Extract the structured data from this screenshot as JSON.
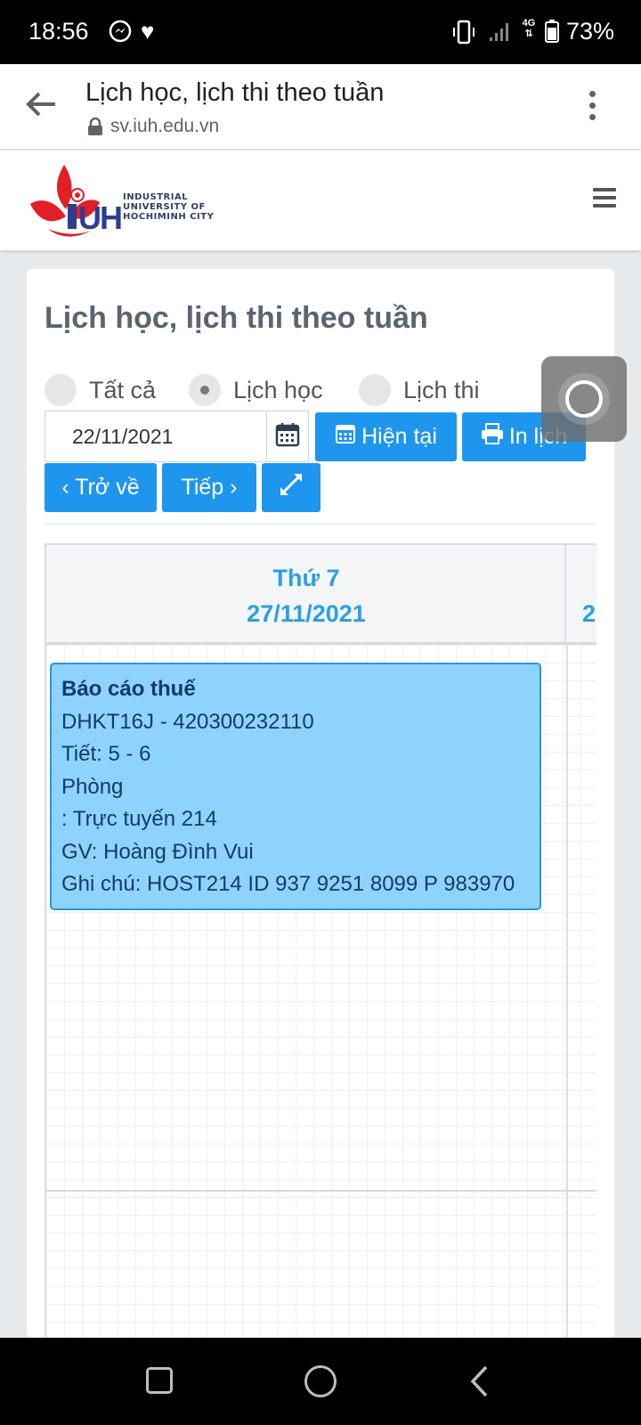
{
  "status_bar": {
    "time": "18:56",
    "network": "4G",
    "battery": "73%",
    "icons": [
      "messenger-icon",
      "heart-icon",
      "vibrate-icon",
      "signal-icon",
      "battery-icon"
    ]
  },
  "browser": {
    "title": "Lịch học, lịch thi theo tuần",
    "url": "sv.iuh.edu.vn"
  },
  "site": {
    "logo_lines": [
      "INDUSTRIAL",
      "UNIVERSITY OF",
      "HOCHIMINH CITY"
    ],
    "logo_letters": "IUH"
  },
  "page": {
    "title": "Lịch học, lịch thi theo tuần"
  },
  "filters": {
    "options": [
      {
        "label": "Tất cả",
        "checked": false
      },
      {
        "label": "Lịch học",
        "checked": true
      },
      {
        "label": "Lịch thi",
        "checked": false
      }
    ]
  },
  "toolbar": {
    "date_value": "22/11/2021",
    "current_label": "Hiện tại",
    "print_label": "In lịch",
    "prev_label": "‹ Trở về",
    "next_label": "Tiếp ›"
  },
  "calendar": {
    "day_name": "Thứ 7",
    "day_date": "27/11/2021",
    "next_col_partial": "2",
    "event": {
      "subject": "Báo cáo thuế",
      "class_code": "DHKT16J - 420300232110",
      "periods": "Tiết: 5 - 6",
      "room_label": "Phòng",
      "room_value": ": Trực tuyến 214",
      "teacher": "GV: Hoàng Đình Vui",
      "note": "Ghi chú: HOST214 ID 937 9251 8099 P 983970"
    }
  },
  "colors": {
    "primary": "#1e96ee",
    "event_bg": "#8ed3fb",
    "event_border": "#2c95d8",
    "header_text": "#2a9fe6",
    "logo_red": "#e31e24",
    "logo_blue": "#2c3e8f"
  }
}
